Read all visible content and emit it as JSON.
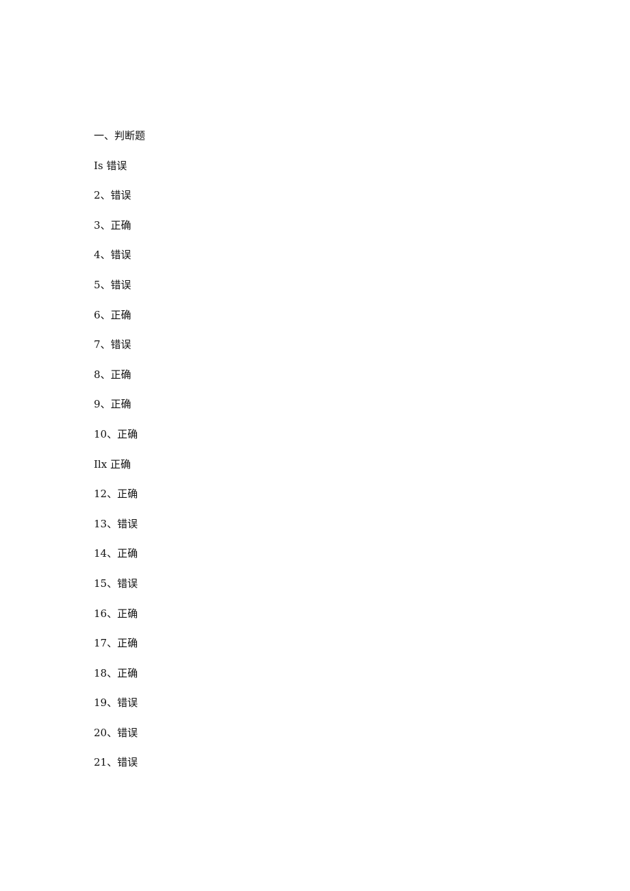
{
  "document": {
    "section_title": "一、判断题",
    "answers": [
      "Is 错误",
      "2、错误",
      "3、正确",
      "4、错误",
      "5、错误",
      "6、正确",
      "7、错误",
      "8、正确",
      "9、正确",
      "10、正确",
      "Ilx 正确",
      "12、正确",
      "13、错误",
      "14、正确",
      "15、错误",
      "16、正确",
      "17、正确",
      "18、正确",
      "19、错误",
      "20、错误",
      "21、错误"
    ]
  }
}
